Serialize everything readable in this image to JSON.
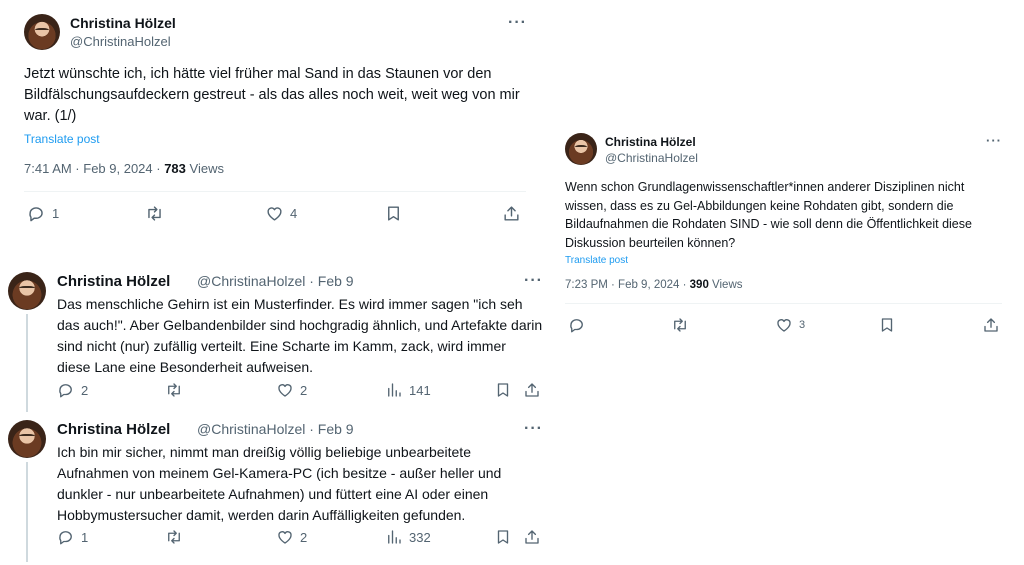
{
  "tweet1": {
    "name": "Christina Hölzel",
    "handle": "@ChristinaHolzel",
    "text": "Jetzt wünschte ich, ich hätte viel früher mal Sand in das Staunen vor den Bildfälschungsaufdeckern gestreut - als das alles noch weit, weit weg von mir war. (1/)",
    "translate": "Translate post",
    "time": "7:41 AM · Feb 9, 2024 · ",
    "views_count": "783",
    "views_label": " Views",
    "replies": "1",
    "likes": "4"
  },
  "tweet2": {
    "name": "Christina Hölzel",
    "handle_date": "@ChristinaHolzel · Feb 9",
    "text": "Das menschliche Gehirn ist ein Musterfinder. Es wird immer sagen \"ich seh das auch!\". Aber Gelbandenbilder sind hochgradig ähnlich, und Artefakte darin sind nicht (nur) zufällig verteilt. Eine Scharte im Kamm, zack, wird immer diese Lane eine Besonderheit aufweisen.",
    "replies": "2",
    "likes": "2",
    "views": "141"
  },
  "tweet3": {
    "name": "Christina Hölzel",
    "handle_date": "@ChristinaHolzel · Feb 9",
    "text": "Ich bin mir sicher, nimmt man dreißig völlig beliebige unbearbeitete Aufnahmen von meinem Gel-Kamera-PC (ich besitze - außer heller und dunkler - nur unbearbeitete Aufnahmen) und füttert eine AI oder einen Hobbymustersucher damit, werden darin Auffälligkeiten gefunden.",
    "replies": "1",
    "likes": "2",
    "views": "332"
  },
  "tweet4": {
    "name": "Christina Hölzel",
    "handle": "@ChristinaHolzel",
    "text": "Wenn schon Grundlagenwissenschaftler*innen anderer Disziplinen nicht wissen, dass es zu Gel-Abbildungen keine Rohdaten gibt, sondern die Bildaufnahmen die Rohdaten SIND - wie soll denn die Öffentlichkeit diese Diskussion beurteilen können?",
    "translate": "Translate post",
    "time": "7:23 PM · Feb 9, 2024 · ",
    "views_count": "390",
    "views_label": " Views",
    "likes": "3"
  },
  "more_glyph": "···",
  "icons": [
    "reply-icon",
    "retweet-icon",
    "like-icon",
    "bookmark-icon",
    "share-icon",
    "views-icon",
    "more-icon"
  ]
}
